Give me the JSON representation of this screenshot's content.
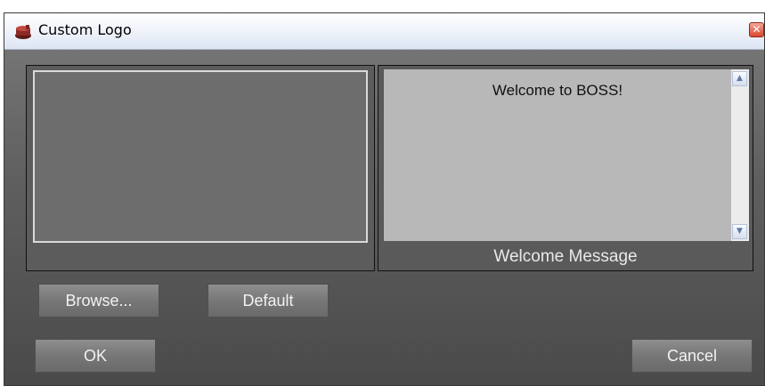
{
  "window": {
    "title": "Custom Logo",
    "close_symbol": "✕",
    "icon": "app-logo-icon"
  },
  "logo": {
    "preview_image": "empty-logo-preview"
  },
  "welcome": {
    "message_text": "Welcome to BOSS!",
    "label": "Welcome Message",
    "scroll_up_symbol": "▲",
    "scroll_down_symbol": "▼"
  },
  "buttons": {
    "browse": "Browse...",
    "default": "Default",
    "ok": "OK",
    "cancel": "Cancel"
  },
  "colors": {
    "dialog_bg": "#5f5f5f",
    "text_area_bg": "#b8b8b8",
    "logo_bg": "#6d6d6d",
    "close_red": "#d9472f"
  }
}
